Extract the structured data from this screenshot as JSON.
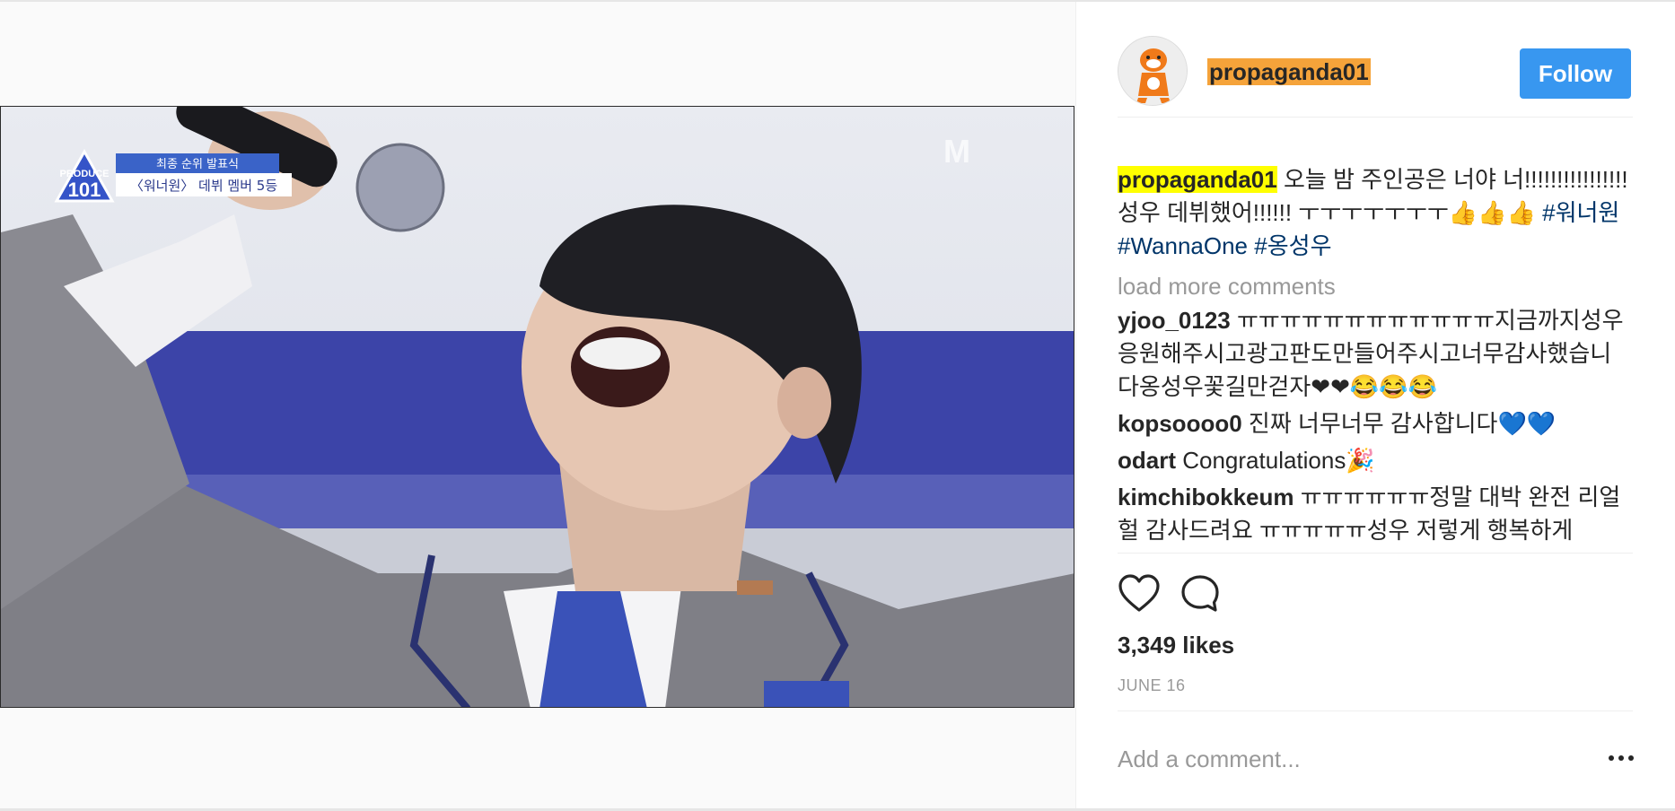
{
  "post": {
    "username": "propaganda01",
    "follow_label": "Follow",
    "caption": {
      "username": "propaganda01",
      "text": "오늘 밤 주인공은 너야 너!!!!!!!!!!!!!!!! 성우 데뷔했어!!!!!! ㅜㅜㅜㅜㅜㅜㅜ👍👍👍",
      "hashtags": [
        "#워너원",
        "#WannaOne",
        "#옹성우"
      ]
    },
    "load_more_label": "load more comments",
    "comments": [
      {
        "username": "yjoo_0123",
        "text": "ㅠㅠㅠㅠㅠㅠㅠㅠㅠㅠㅠㅠ지금까지성우응원해주시고광고판도만들어주시고너무감사했습니다옹성우꽃길만걷자❤❤😂😂😂"
      },
      {
        "username": "kopsoooo0",
        "text": "진짜 너무너무 감사합니다💙💙"
      },
      {
        "username": "odart",
        "text": "Congratulations🎉"
      },
      {
        "username": "kimchibokkeum",
        "text": "ㅠㅠㅠㅠㅠㅠ정말 대박 완전 리얼 헐 감사드려요 ㅠㅠㅠㅠㅠ성우 저렇게 행복하게"
      }
    ],
    "likes": "3,349 likes",
    "date": "JUNE 16",
    "add_comment_placeholder": "Add a comment...",
    "icons": {
      "like": "heart-icon",
      "comment": "comment-bubble-icon",
      "more": "more-options-icon"
    }
  },
  "video_overlay": {
    "show_logo_line1": "PRODUCE",
    "show_logo_line2": "101",
    "caption_line1": "최종 순위 발표식",
    "caption_line2": "〈워너원〉 데뷔 멤버 5등",
    "channel_logo": "M"
  },
  "colors": {
    "follow_button": "#3897f0",
    "username_highlight_header": "#f5a33a",
    "username_highlight_caption": "#ffff00",
    "hashtag": "#003569"
  }
}
